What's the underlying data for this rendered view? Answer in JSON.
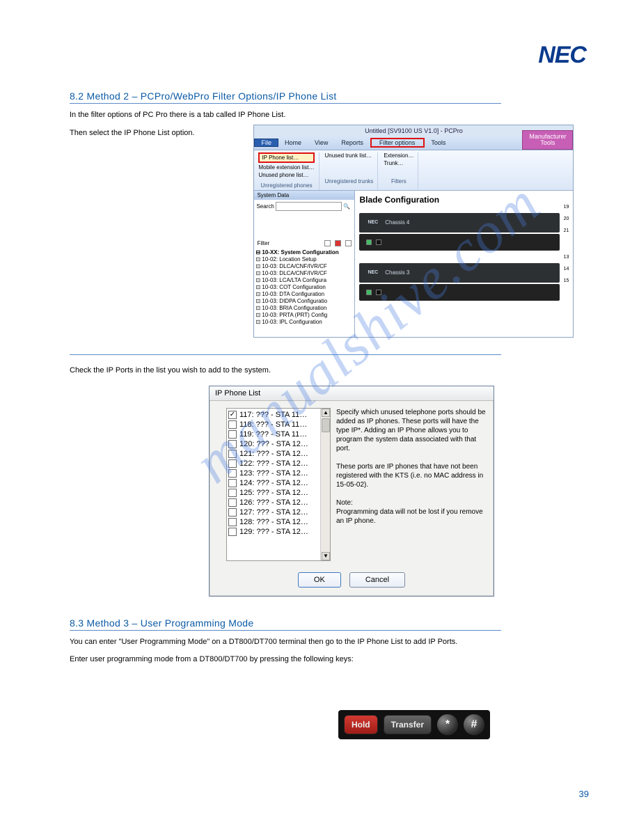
{
  "brand": "NEC",
  "sections": {
    "sec8_2": {
      "heading": "8.2  Method 2 – PCPro/WebPro Filter Options/IP Phone List",
      "intro": "In the filter options of PC Pro there is a tab called IP Phone List."
    },
    "sec8_3": {
      "heading": "8.3  Method 3 – User Programming Mode",
      "intro_a": "You can enter \"User Programming Mode\" on a DT800/DT700 terminal then go to the IP Phone List to add IP Ports.",
      "intro_b": "Enter user programming mode from a DT800/DT700 by pressing the following keys:"
    }
  },
  "figure1": {
    "caption": "Then select the IP Phone List option.",
    "window_title": "Untitled [SV9100 US V1.0] - PCPro",
    "tabs": {
      "file": "File",
      "home": "Home",
      "view": "View",
      "reports": "Reports",
      "filter": "Filter options",
      "tools1": "Tools",
      "manufacturer": "Manufacturer",
      "tools2": "Tools"
    },
    "ribbon": {
      "ip_phone_list": "IP Phone list…",
      "mobile_ext": "Mobile extension list…",
      "unused_phone": "Unused phone list…",
      "group1": "Unregistered phones",
      "unused_trunk": "Unused trunk list…",
      "group2": "Unregistered trunks",
      "extension": "Extension…",
      "trunk": "Trunk…",
      "group3": "Filters"
    },
    "system_data_hdr": "System Data",
    "search_label": "Search",
    "filter_label": "Filter",
    "tree_root": "10-XX: System Configuration",
    "tree_items": [
      "10-02: Location Setup",
      "10-03: DLCA/CNF/IVR/CF",
      "10-03: DLCA/CNF/IVR/CF",
      "10-03: LCA/LTA Configura",
      "10-03: COT Configuration",
      "10-03: DTA Configuration",
      "10-03: DIDPA Configuratio",
      "10-03: BRIA Configuration",
      "10-03: PRTA (PRT) Config",
      "10-03: IPL Configuration"
    ],
    "blade_title": "Blade Configuration",
    "chassis4": "Chassis 4",
    "chassis3": "Chassis 3",
    "slots_a": [
      "19",
      "20",
      "21"
    ],
    "slots_b": [
      "13",
      "14",
      "15"
    ]
  },
  "figure2": {
    "caption": "Check the IP Ports in the list you wish to add to the system.",
    "title": "IP Phone List",
    "items": [
      {
        "checked": true,
        "label": "117: ??? - STA 11…"
      },
      {
        "checked": false,
        "label": "118: ??? - STA 11…"
      },
      {
        "checked": false,
        "label": "119: ??? - STA 11…"
      },
      {
        "checked": false,
        "label": "120: ??? - STA 12…"
      },
      {
        "checked": false,
        "label": "121: ??? - STA 12…"
      },
      {
        "checked": false,
        "label": "122: ??? - STA 12…"
      },
      {
        "checked": false,
        "label": "123: ??? - STA 12…"
      },
      {
        "checked": false,
        "label": "124: ??? - STA 12…"
      },
      {
        "checked": false,
        "label": "125: ??? - STA 12…"
      },
      {
        "checked": false,
        "label": "126: ??? - STA 12…"
      },
      {
        "checked": false,
        "label": "127: ??? - STA 12…"
      },
      {
        "checked": false,
        "label": "128: ??? - STA 12…"
      },
      {
        "checked": false,
        "label": "129: ??? - STA 12…"
      }
    ],
    "para1": "Specify which unused telephone ports should be added as IP phones. These ports will have the type IP*. Adding an IP Phone allows you to program the system data associated with that port.",
    "para2": "These ports are IP phones that have not been registered with the KTS (i.e. no MAC address in 15-05-02).",
    "para3": "Note:\nProgramming data will not be lost if you remove an IP phone.",
    "ok": "OK",
    "cancel": "Cancel"
  },
  "phone_buttons": {
    "hold": "Hold",
    "transfer": "Transfer",
    "star": "*",
    "hash": "#"
  },
  "watermark": "manualshive.com",
  "page_number": "39"
}
